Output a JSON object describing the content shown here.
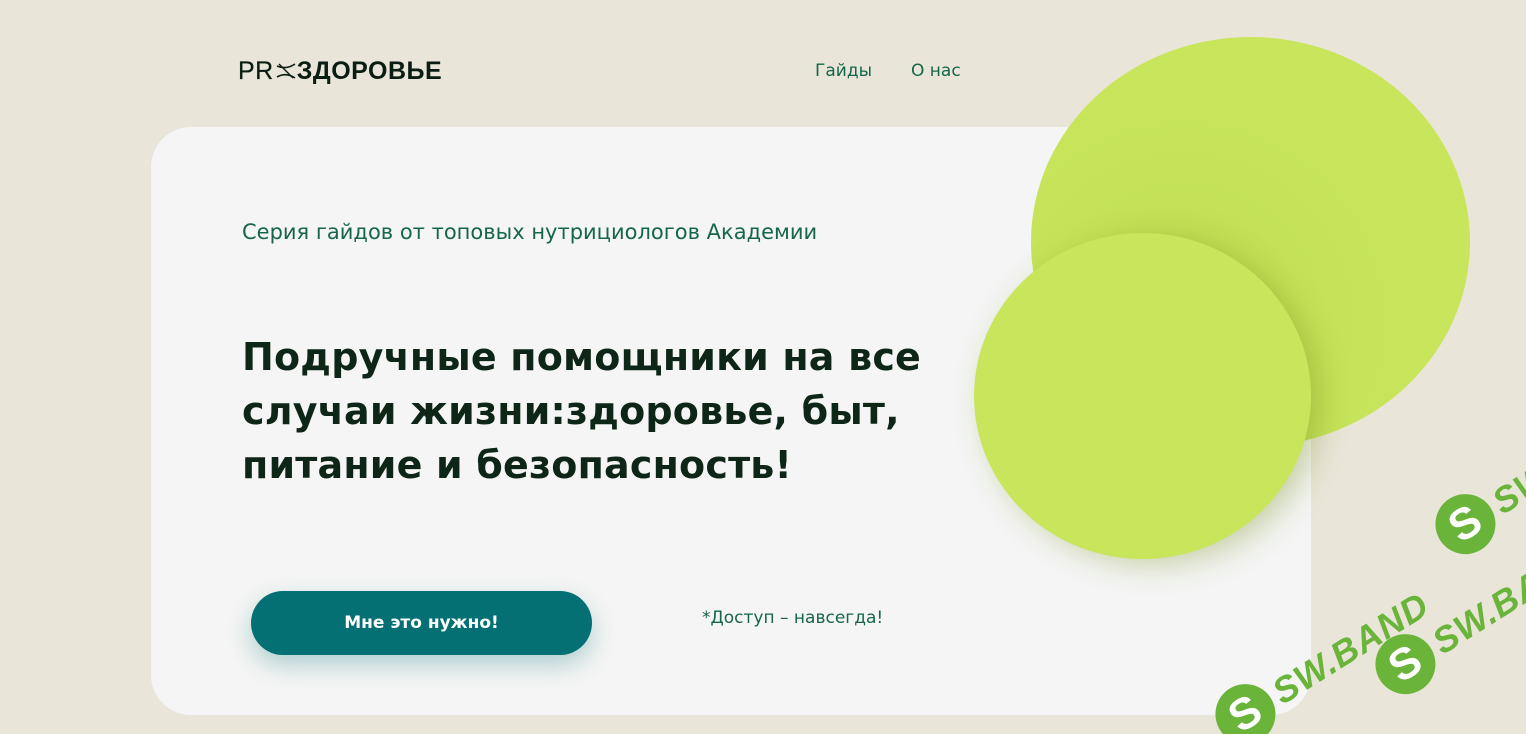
{
  "header": {
    "logo": {
      "prefix": "PR",
      "name": "ЗДОРОВЬЕ"
    },
    "nav": [
      {
        "label": "Гайды"
      },
      {
        "label": "О нас"
      }
    ]
  },
  "hero": {
    "subtitle": "Серия гайдов от топовых нутрициологов Академии",
    "headline_lines": [
      "Подручные помощники на все",
      "случаи жизни:здоровье, быт,",
      "питание и безопасность!"
    ],
    "cta_label": "Мне это нужно!",
    "access_note": "*Доступ – навсегда!"
  },
  "watermark": {
    "text": "SW.BAND",
    "badge": "S"
  },
  "colors": {
    "background": "#e9e5d8",
    "card": "#f4f5f4",
    "accent_green": "#c7e45a",
    "button_teal": "#047074",
    "text_green": "#15664a",
    "headline_dark": "#0e2618",
    "watermark_green": "#6ab43a"
  }
}
